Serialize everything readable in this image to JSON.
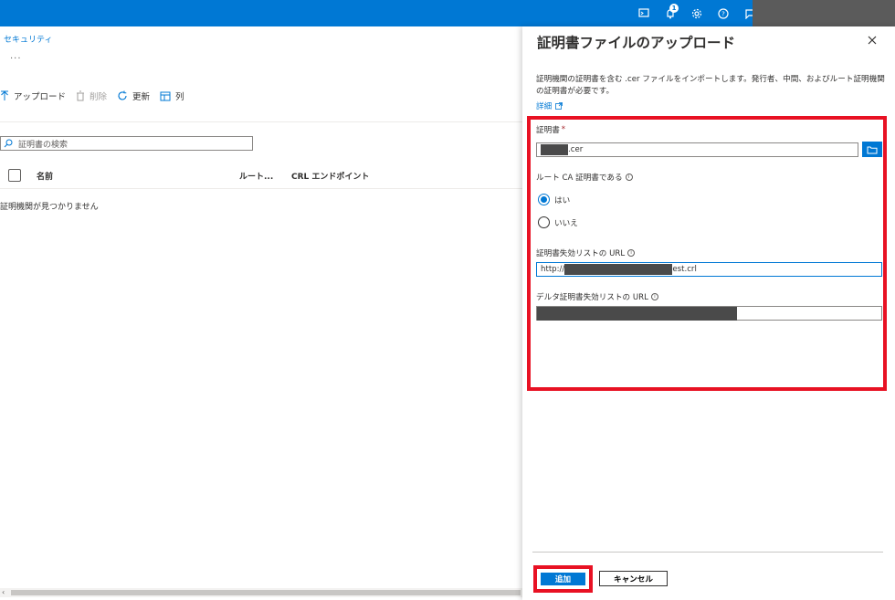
{
  "topbar": {
    "notification_count": "1",
    "icons": [
      "cloud-shell-icon",
      "bell-icon",
      "gear-icon",
      "help-icon",
      "feedback-icon"
    ]
  },
  "left": {
    "breadcrumb": "セキュリティ",
    "ellipsis": "...",
    "toolbar": {
      "upload": "アップロード",
      "delete": "削除",
      "refresh": "更新",
      "columns": "列"
    },
    "search_placeholder": "証明書の検索",
    "columns": [
      "名前",
      "ルート...",
      "CRL エンドポイント"
    ],
    "empty_message": "証明機関が見つかりません"
  },
  "panel": {
    "title": "証明書ファイルのアップロード",
    "description": "証明機関の証明書を含む .cer ファイルをインポートします。発行者、中間、およびルート証明機関の証明書が必要です。",
    "more_link": "詳細",
    "cert_label": "証明書",
    "required_mark": "*",
    "cert_value_suffix": ".cer",
    "root_ca_label": "ルート CA 証明書である",
    "radio_yes": "はい",
    "radio_no": "いいえ",
    "crl_label": "証明書失効リストの URL",
    "crl_value_prefix": "http://",
    "crl_value_suffix": "est.crl",
    "delta_crl_label": "デルタ証明書失効リストの URL",
    "add_button": "追加",
    "cancel_button": "キャンセル"
  },
  "colors": {
    "accent": "#0078d4",
    "highlight": "#e81123"
  }
}
